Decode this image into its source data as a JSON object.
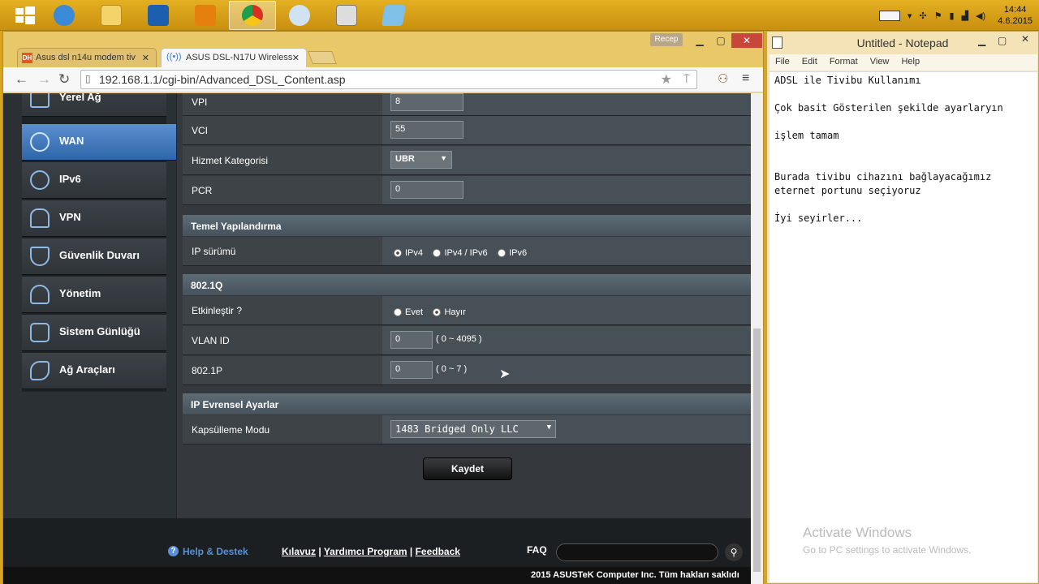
{
  "taskbar": {
    "clock_time": "14:44",
    "clock_date": "4.6.2015",
    "apps": [
      "start",
      "ie",
      "explorer",
      "lync",
      "outlook",
      "chrome",
      "paint",
      "scanner",
      "notepad"
    ]
  },
  "browser": {
    "tabs": [
      {
        "label": "Asus dsl n14u modem tiv",
        "icon": "dh"
      },
      {
        "label": "ASUS DSL-N17U Wireless",
        "icon": "wireless"
      }
    ],
    "user_badge": "Recep",
    "url": "192.168.1.1/cgi-bin/Advanced_DSL_Content.asp"
  },
  "sidebar": {
    "items": [
      {
        "label": "Yerel Ağ",
        "icon": "home-icon"
      },
      {
        "label": "WAN",
        "icon": "globe-icon"
      },
      {
        "label": "IPv6",
        "icon": "ipv6-icon"
      },
      {
        "label": "VPN",
        "icon": "vpn-icon"
      },
      {
        "label": "Güvenlik Duvarı",
        "icon": "shield-icon"
      },
      {
        "label": "Yönetim",
        "icon": "user-icon"
      },
      {
        "label": "Sistem Günlüğü",
        "icon": "log-icon"
      },
      {
        "label": "Ağ Araçları",
        "icon": "tools-icon"
      }
    ]
  },
  "form": {
    "vpi": {
      "label": "VPI",
      "value": "8"
    },
    "vci": {
      "label": "VCI",
      "value": "55"
    },
    "service": {
      "label": "Hizmet Kategorisi",
      "value": "UBR"
    },
    "pcr": {
      "label": "PCR",
      "value": "0"
    },
    "basic_section": "Temel Yapılandırma",
    "ip_version": {
      "label": "IP sürümü",
      "options": [
        "IPv4",
        "IPv4 / IPv6",
        "IPv6"
      ],
      "selected": "IPv4"
    },
    "dot1q_section": "802.1Q",
    "enable": {
      "label": "Etkinleştir ?",
      "options": [
        "Evet",
        "Hayır"
      ],
      "selected": "Hayır"
    },
    "vlan_id": {
      "label": "VLAN ID",
      "value": "0",
      "range": "( 0 ~ 4095 )"
    },
    "dot1p": {
      "label": "802.1P",
      "value": "0",
      "range": "( 0 ~ 7 )"
    },
    "global_section": "IP Evrensel Ayarlar",
    "encap": {
      "label": "Kapsülleme Modu",
      "value": "1483 Bridged Only LLC"
    },
    "save_button": "Kaydet"
  },
  "footer": {
    "help": "Help & Destek",
    "manual": "Kılavuz",
    "utility": "Yardımcı Program",
    "feedback": "Feedback",
    "faq": "FAQ",
    "copyright": "2015 ASUSTeK Computer Inc. Tüm hakları saklıdı"
  },
  "notepad": {
    "title": "Untitled - Notepad",
    "menu": [
      "File",
      "Edit",
      "Format",
      "View",
      "Help"
    ],
    "text": "ADSL ile Tivibu Kullanımı\n\nÇok basit Gösterilen şekilde ayarlaryın\n\nişlem tamam\n\n\nBurada tivibu cihazını bağlayacağımız\neternet portunu seçiyoruz\n\nİyi seyirler..."
  },
  "watermark": {
    "line1": "Activate Windows",
    "line2": "Go to PC settings to activate Windows."
  },
  "colors": {
    "accent": "#2f66a9",
    "taskbar": "#d9a520"
  }
}
